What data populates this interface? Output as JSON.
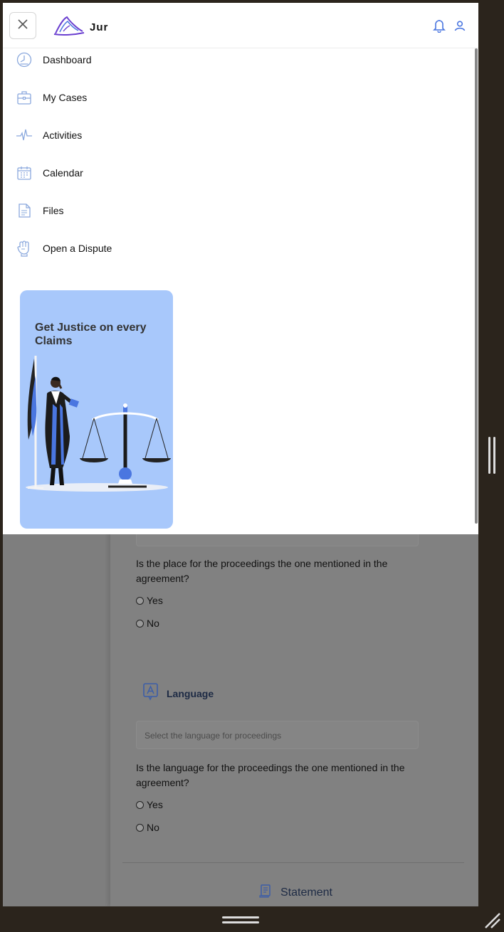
{
  "header": {
    "logo_text": "Jur",
    "icons": [
      "close-icon",
      "logo-icon",
      "bell-icon",
      "user-icon"
    ]
  },
  "menu": {
    "items": [
      {
        "label": "Dashboard",
        "icon": "dashboard-icon"
      },
      {
        "label": "My Cases",
        "icon": "briefcase-icon"
      },
      {
        "label": "Activities",
        "icon": "activity-icon"
      },
      {
        "label": "Calendar",
        "icon": "calendar-icon"
      },
      {
        "label": "Files",
        "icon": "file-icon"
      },
      {
        "label": "Open a Dispute",
        "icon": "fist-icon"
      }
    ]
  },
  "promo": {
    "text": "Get Justice on every Claims"
  },
  "form": {
    "place_question": "Is the place for the proceedings the one mentioned in the agreement?",
    "place_options": [
      "Yes",
      "No"
    ],
    "language_title": "Language",
    "language_placeholder": "Select the language for proceedings",
    "language_question": "Is the language for the proceedings the one mentioned in the agreement?",
    "language_options": [
      "Yes",
      "No"
    ],
    "statement_label": "Statement"
  },
  "colors": {
    "accent": "#4a76e0",
    "promo_bg": "#a8c8fb",
    "logo_purple": "#6a3fd0"
  }
}
